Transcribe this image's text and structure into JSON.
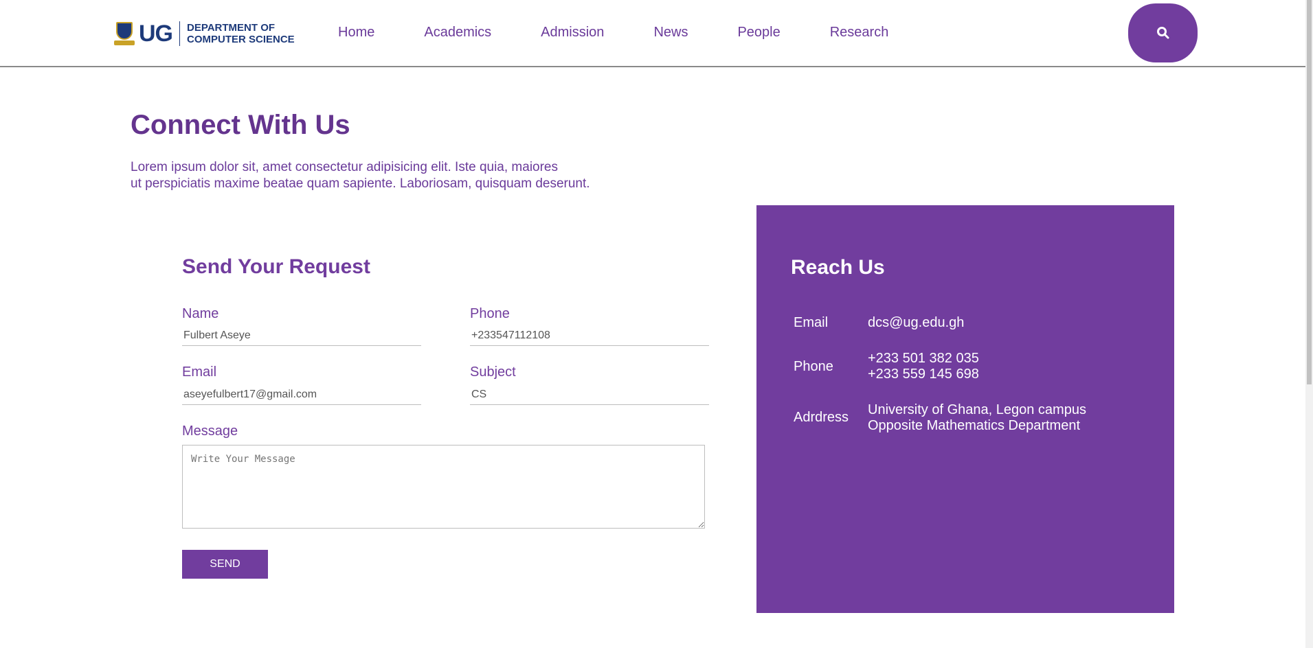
{
  "header": {
    "logo_text": "UG",
    "dept_line1": "DEPARTMENT OF",
    "dept_line2": "COMPUTER SCIENCE",
    "nav": [
      "Home",
      "Academics",
      "Admission",
      "News",
      "People",
      "Research"
    ],
    "search_icon": "search-icon",
    "accent_color": "#713d9e"
  },
  "intro": {
    "title": "Connect With Us",
    "line1": "Lorem ipsum dolor sit, amet consectetur adipisicing elit. Iste quia, maiores",
    "line2": "ut perspiciatis maxime beatae quam sapiente. Laboriosam, quisquam deserunt."
  },
  "form": {
    "title": "Send Your Request",
    "name_label": "Name",
    "name_value": "Fulbert Aseye",
    "phone_label": "Phone",
    "phone_value": "+233547112108",
    "email_label": "Email",
    "email_value": "aseyefulbert17@gmail.com",
    "subject_label": "Subject",
    "subject_value": "CS",
    "message_label": "Message",
    "message_placeholder": "Write Your Message",
    "send_label": "SEND"
  },
  "reach": {
    "title": "Reach Us",
    "email_label": "Email",
    "email_value": "dcs@ug.edu.gh",
    "phone_label": "Phone",
    "phone_value1": "+233 501 382 035",
    "phone_value2": "+233 559 145 698",
    "address_label": "Adrdress",
    "address_line1": "University of Ghana, Legon campus",
    "address_line2": "Opposite Mathematics Department"
  }
}
